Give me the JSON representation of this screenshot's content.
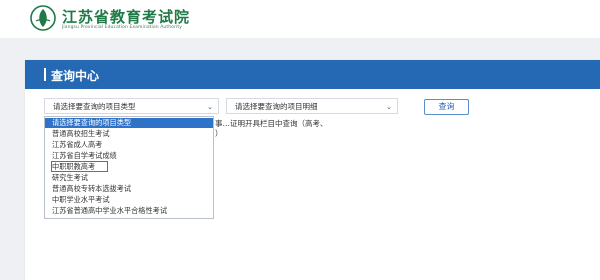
{
  "header": {
    "title": "江苏省教育考试院",
    "subtitle": "Jiangsu Provincial Education Examination Authority",
    "logo_icon": "emblem-icon"
  },
  "card": {
    "title": "查询中心"
  },
  "select_type": {
    "value": "请选择要查询的项目类型"
  },
  "select_detail": {
    "value": "请选择要查询的项目明细"
  },
  "query_button": {
    "label": "查询"
  },
  "note": {
    "line1": "事…证明开具栏目中查询（高考、",
    "line2": "）"
  },
  "dropdown": {
    "options": [
      "请选择要查询的项目类型",
      "普通高校招生考试",
      "江苏省成人高考",
      "江苏省自学考试成绩",
      "中职职教高考",
      "研究生考试",
      "普通高校专转本选拔考试",
      "中职学业水平考试",
      "江苏省普通高中学业水平合格性考试"
    ],
    "highlighted_index": 0,
    "outlined_index": 4
  },
  "colors": {
    "brand_green": "#1f7a47",
    "bar_blue": "#2568b4",
    "highlight_blue": "#2f73c9",
    "outline_red": "#e23b3b"
  }
}
